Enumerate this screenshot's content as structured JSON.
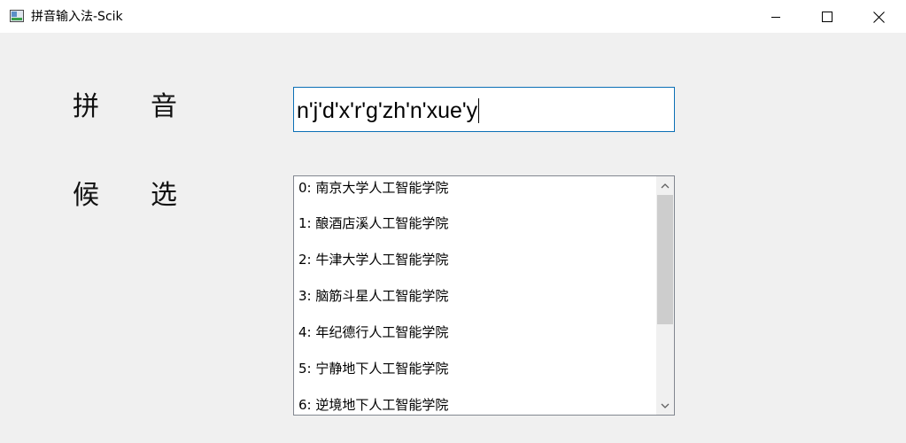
{
  "window": {
    "title": "拼音输入法-Scik",
    "icons": {
      "app": "app-window-icon",
      "minimize": "minimize-icon",
      "maximize": "maximize-icon",
      "close": "close-icon"
    }
  },
  "form": {
    "pinyin_label_chars": [
      "拼",
      "音"
    ],
    "candidates_label_chars": [
      "候",
      "选"
    ],
    "pinyin_value": "n'j'd'x'r'g'zh'n'xue'y"
  },
  "candidates": [
    "0: 南京大学人工智能学院",
    "1: 酿酒店溪人工智能学院",
    "2: 牛津大学人工智能学院",
    "3: 脑筋斗星人工智能学院",
    "4: 年纪德行人工智能学院",
    "5: 宁静地下人工智能学院",
    "6: 逆境地下人工智能学院"
  ],
  "colors": {
    "window_bg": "#f0f0f0",
    "titlebar_bg": "#ffffff",
    "input_focus_border": "#0b6fb5",
    "list_border": "#828790",
    "scroll_thumb": "#cdcdcd"
  }
}
